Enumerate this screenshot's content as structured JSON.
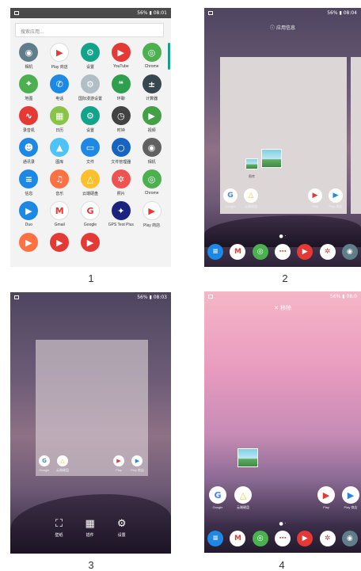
{
  "status": {
    "battery": "56%",
    "time1": "08:01",
    "time2": "08:04",
    "time3": "08:03",
    "time4": "08:0"
  },
  "captions": [
    "1",
    "2",
    "3",
    "4"
  ],
  "drawer": {
    "search_placeholder": "搜索应用...",
    "apps": [
      {
        "label": "相机",
        "icon": "camera-icon",
        "color": "#607d8b",
        "glyph": "◉"
      },
      {
        "label": "Play 商店",
        "icon": "play-store-icon",
        "color": "#ffffff",
        "glyph": "▶"
      },
      {
        "label": "设置",
        "icon": "settings-icon",
        "color": "#13a38a",
        "glyph": "⚙"
      },
      {
        "label": "YouTube",
        "icon": "youtube-icon",
        "color": "#e53935",
        "glyph": "▶"
      },
      {
        "label": "Chrome",
        "icon": "chrome-icon",
        "color": "#4caf50",
        "glyph": "◎"
      },
      {
        "label": "地图",
        "icon": "maps-icon",
        "color": "#4caf50",
        "glyph": "⌖"
      },
      {
        "label": "电话",
        "icon": "phone-icon",
        "color": "#1e88e5",
        "glyph": "✆"
      },
      {
        "label": "国际漫游设置",
        "icon": "roaming-icon",
        "color": "#b0bec5",
        "glyph": "⚙"
      },
      {
        "label": "环聊",
        "icon": "hangouts-icon",
        "color": "#2e9e4f",
        "glyph": "❝"
      },
      {
        "label": "计算器",
        "icon": "calculator-icon",
        "color": "#37474f",
        "glyph": "±"
      },
      {
        "label": "录音机",
        "icon": "recorder-icon",
        "color": "#e53935",
        "glyph": "∿"
      },
      {
        "label": "日历",
        "icon": "calendar-icon",
        "color": "#8bc34a",
        "glyph": "▦"
      },
      {
        "label": "设置",
        "icon": "settings-icon",
        "color": "#13a38a",
        "glyph": "⚙"
      },
      {
        "label": "时钟",
        "icon": "clock-icon",
        "color": "#424242",
        "glyph": "◷"
      },
      {
        "label": "视频",
        "icon": "video-icon",
        "color": "#43a047",
        "glyph": "▶"
      },
      {
        "label": "通讯录",
        "icon": "contacts-icon",
        "color": "#1e88e5",
        "glyph": "☻"
      },
      {
        "label": "图库",
        "icon": "gallery-icon",
        "color": "#4fc3f7",
        "glyph": "▲"
      },
      {
        "label": "文件",
        "icon": "files-icon",
        "color": "#1e88e5",
        "glyph": "▭"
      },
      {
        "label": "文件管理器",
        "icon": "file-manager-icon",
        "color": "#1565c0",
        "glyph": "○"
      },
      {
        "label": "相机",
        "icon": "camera-icon",
        "color": "#616161",
        "glyph": "◉"
      },
      {
        "label": "信息",
        "icon": "messages-icon",
        "color": "#1e88e5",
        "glyph": "≡"
      },
      {
        "label": "音乐",
        "icon": "music-icon",
        "color": "#ff7043",
        "glyph": "♫"
      },
      {
        "label": "云端硬盘",
        "icon": "drive-icon",
        "color": "#fbc02d",
        "glyph": "△"
      },
      {
        "label": "照片",
        "icon": "photos-icon",
        "color": "#ef5350",
        "glyph": "✲"
      },
      {
        "label": "Chrome",
        "icon": "chrome-icon",
        "color": "#4caf50",
        "glyph": "◎"
      },
      {
        "label": "Duo",
        "icon": "duo-icon",
        "color": "#1e88e5",
        "glyph": "▶"
      },
      {
        "label": "Gmail",
        "icon": "gmail-icon",
        "color": "#ffffff",
        "glyph": "M"
      },
      {
        "label": "Google",
        "icon": "google-icon",
        "color": "#ffffff",
        "glyph": "G"
      },
      {
        "label": "GPS Test Plus",
        "icon": "gps-icon",
        "color": "#1a237e",
        "glyph": "✦"
      },
      {
        "label": "Play 商店",
        "icon": "play-store-icon",
        "color": "#ffffff",
        "glyph": "▶"
      },
      {
        "label": "",
        "icon": "play-music-icon",
        "color": "#ff7043",
        "glyph": "▶"
      },
      {
        "label": "",
        "icon": "play-movies-icon",
        "color": "#e53935",
        "glyph": "▶"
      },
      {
        "label": "",
        "icon": "youtube-icon",
        "color": "#e53935",
        "glyph": "▶"
      }
    ]
  },
  "home": {
    "app_info": "应用信息",
    "widget_label": "图库",
    "remove": "✕ 移除",
    "screen_icons": [
      {
        "label": "Google",
        "glyph": "G"
      },
      {
        "label": "云端硬盘",
        "glyph": "△"
      },
      {
        "label": "Play",
        "glyph": "▶"
      },
      {
        "label": "Play 商店",
        "glyph": "▶"
      }
    ],
    "dock": [
      {
        "icon": "messages-icon",
        "glyph": "≡",
        "color": "#1e88e5"
      },
      {
        "icon": "gmail-icon",
        "glyph": "M",
        "color": "#ffffff"
      },
      {
        "icon": "chrome-icon",
        "glyph": "◎",
        "color": "#4caf50"
      },
      {
        "icon": "app-drawer-icon",
        "glyph": "⋯",
        "color": "#ffffff"
      },
      {
        "icon": "youtube-icon",
        "glyph": "▶",
        "color": "#e53935"
      },
      {
        "icon": "photos-icon",
        "glyph": "✲",
        "color": "#ffffff"
      },
      {
        "icon": "camera-icon",
        "glyph": "◉",
        "color": "#607d8b"
      }
    ]
  },
  "menu": [
    {
      "label": "壁纸",
      "glyph": "⛶"
    },
    {
      "label": "插件",
      "glyph": "▦"
    },
    {
      "label": "设置",
      "glyph": "⚙"
    }
  ]
}
